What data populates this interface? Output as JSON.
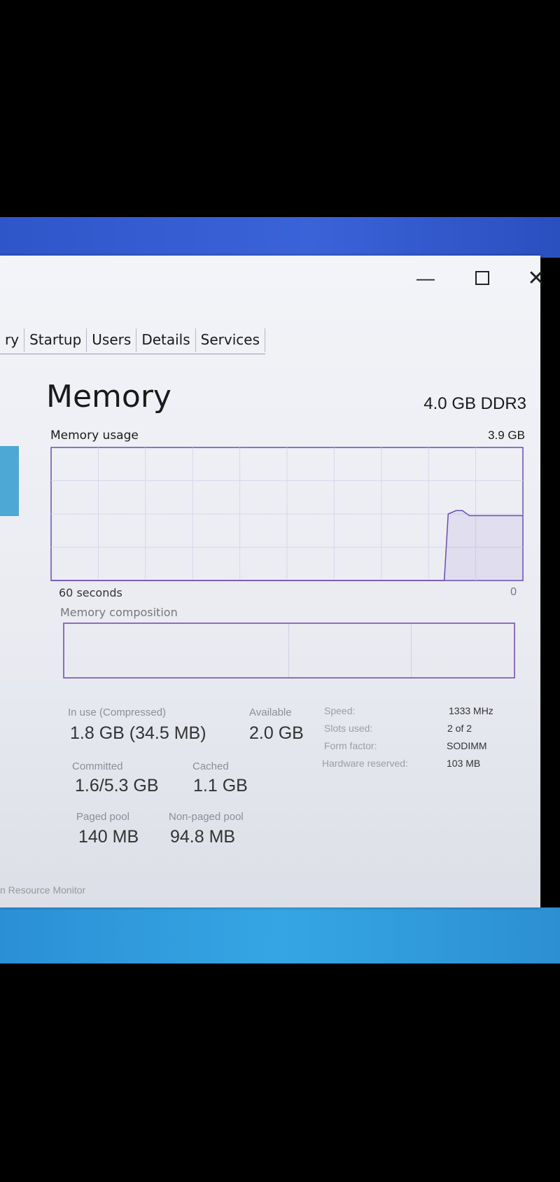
{
  "window": {
    "minimize_glyph": "—",
    "close_glyph": "✕"
  },
  "tabs": [
    "ry",
    "Startup",
    "Users",
    "Details",
    "Services"
  ],
  "header": {
    "title": "Memory",
    "spec": "4.0 GB DDR3"
  },
  "usage_graph": {
    "label": "Memory usage",
    "max_label": "3.9 GB",
    "time_label": "60 seconds",
    "min_label": "0",
    "line_color": "#6a4bb5"
  },
  "chart_data": {
    "type": "area",
    "x_range": [
      60,
      0
    ],
    "ylim": [
      0,
      3.9
    ],
    "series": [
      {
        "values": [
          [
            60,
            0
          ],
          [
            10,
            0
          ],
          [
            9.5,
            1.95
          ],
          [
            8.5,
            2.05
          ],
          [
            7.7,
            2.05
          ],
          [
            6.8,
            1.9
          ],
          [
            0,
            1.9
          ]
        ]
      }
    ]
  },
  "composition": {
    "label": "Memory composition"
  },
  "stats": {
    "in_use_label": "In use (Compressed)",
    "in_use_value": "1.8 GB (34.5 MB)",
    "available_label": "Available",
    "available_value": "2.0 GB",
    "committed_label": "Committed",
    "committed_value": "1.6/5.3 GB",
    "cached_label": "Cached",
    "cached_value": "1.1 GB",
    "paged_label": "Paged pool",
    "paged_value": "140 MB",
    "nonpaged_label": "Non-paged pool",
    "nonpaged_value": "94.8 MB"
  },
  "details": {
    "speed_label": "Speed:",
    "speed_value": "1333 MHz",
    "slots_label": "Slots used:",
    "slots_value": "2 of 2",
    "form_label": "Form factor:",
    "form_value": "SODIMM",
    "hw_label": "Hardware reserved:",
    "hw_value": "103 MB"
  },
  "footer": {
    "link": "n Resource Monitor"
  }
}
